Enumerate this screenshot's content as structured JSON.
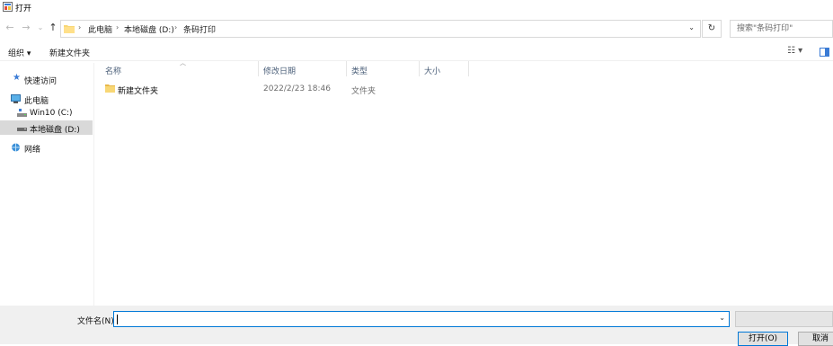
{
  "window": {
    "title": "打开"
  },
  "address": {
    "crumbs": [
      "此电脑",
      "本地磁盘 (D:)",
      "条码打印"
    ],
    "search_placeholder": "搜索\"条码打印\""
  },
  "toolbar": {
    "organize": "组织 ▾",
    "new_folder": "新建文件夹"
  },
  "navpane": {
    "items": [
      {
        "label": "快速访问",
        "icon": "pin-icon"
      },
      {
        "label": "此电脑",
        "icon": "computer-icon"
      },
      {
        "label": "Win10 (C:)",
        "icon": "drive-icon"
      },
      {
        "label": "本地磁盘 (D:)",
        "icon": "drive-icon",
        "selected": true
      },
      {
        "label": "网络",
        "icon": "network-icon"
      }
    ]
  },
  "filelist": {
    "columns": [
      "名称",
      "修改日期",
      "类型",
      "大小"
    ],
    "rows": [
      {
        "name": "新建文件夹",
        "modified": "2022/2/23 18:46",
        "type": "文件夹",
        "size": ""
      }
    ]
  },
  "footer": {
    "filename_label": "文件名(N):",
    "filename_value": "",
    "open_button": "打开(O)",
    "cancel_button": "取消"
  },
  "colors": {
    "accent": "#0078d7",
    "selected_bg": "#d9d9d9",
    "folder": "#f8d775"
  }
}
